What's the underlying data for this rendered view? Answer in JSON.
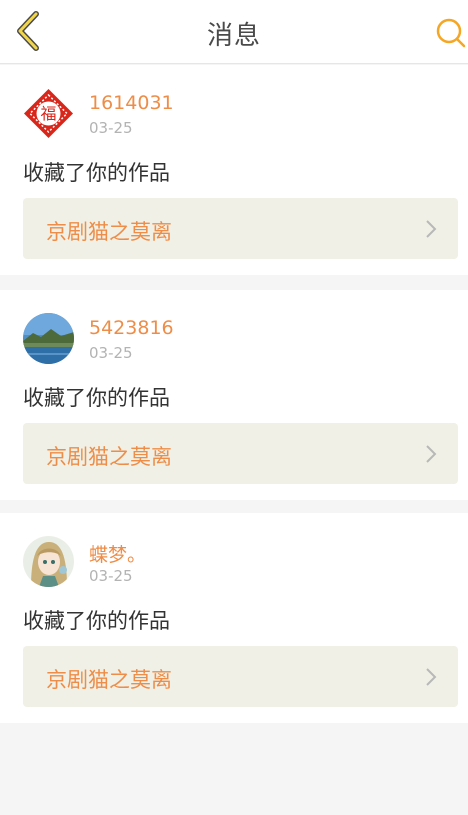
{
  "header": {
    "title": "消息",
    "accent_color": "#f5a623"
  },
  "messages": [
    {
      "username": "1614031",
      "date": "03-25",
      "action": "收藏了你的作品",
      "work_title": "京剧猫之莫离",
      "avatar": "fu-character-icon"
    },
    {
      "username": "5423816",
      "date": "03-25",
      "action": "收藏了你的作品",
      "work_title": "京剧猫之莫离",
      "avatar": "landscape-photo"
    },
    {
      "username": "蝶梦。",
      "date": "03-25",
      "action": "收藏了你的作品",
      "work_title": "京剧猫之莫离",
      "avatar": "anime-girl-illustration"
    }
  ],
  "colors": {
    "username": "#ee8d47",
    "link_bg": "#f1f0e6",
    "page_bg": "#f5f5f5"
  }
}
